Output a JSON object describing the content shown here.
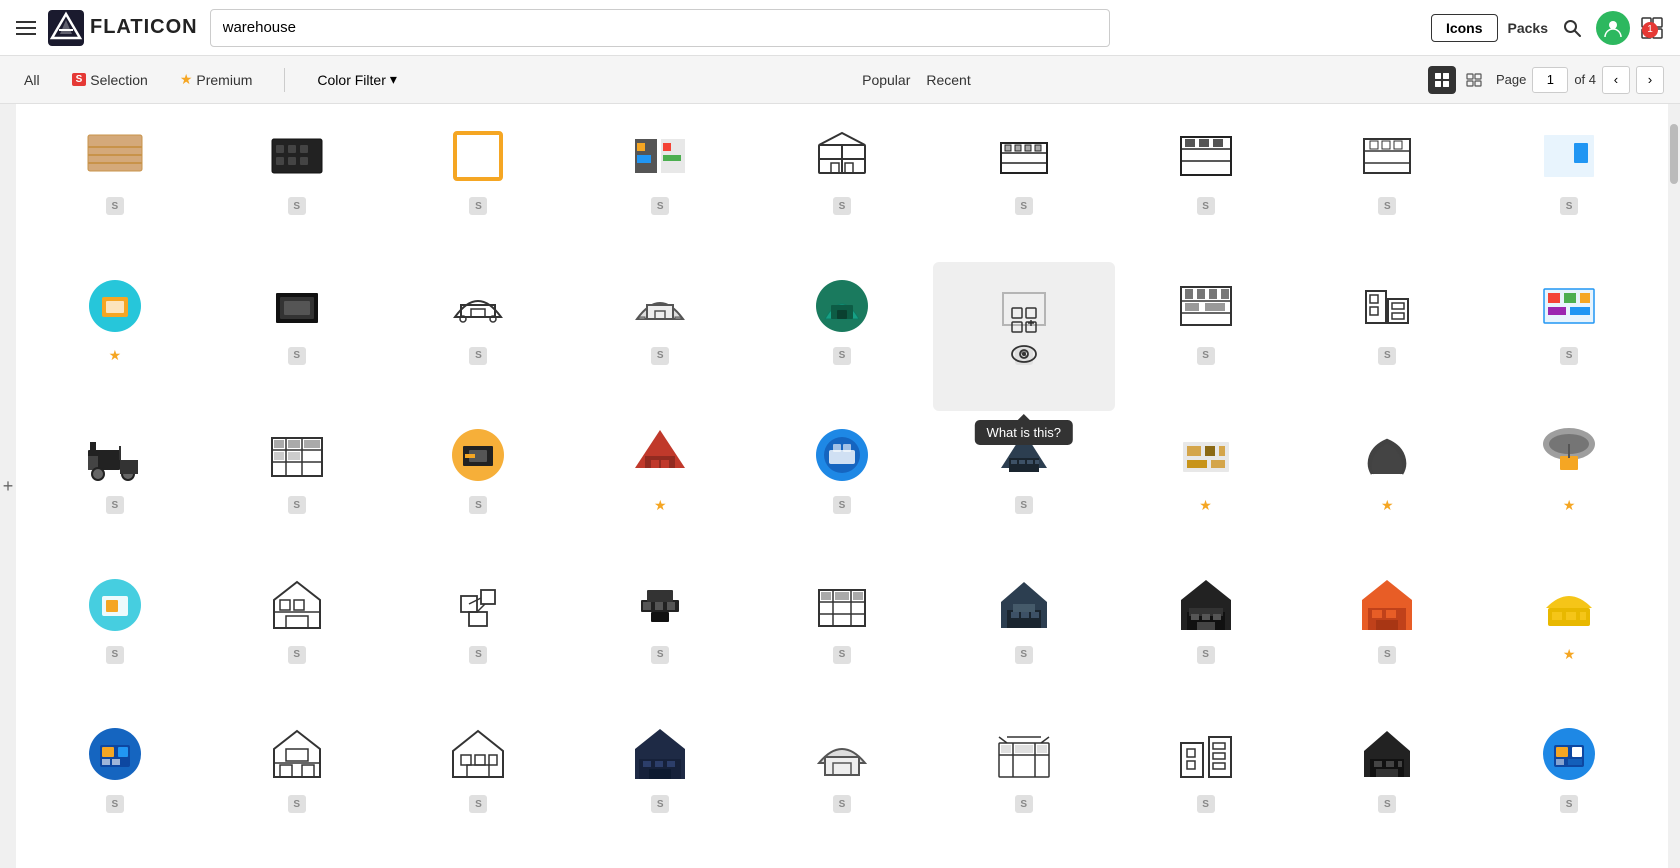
{
  "header": {
    "search_placeholder": "warehouse",
    "search_value": "warehouse",
    "btn_icons": "Icons",
    "btn_packs": "Packs",
    "notification_count": "1",
    "grid_view": "grid-view"
  },
  "subheader": {
    "tab_all": "All",
    "tab_selection": "Selection",
    "tab_premium": "Premium",
    "color_filter": "Color Filter",
    "popular": "Popular",
    "recent": "Recent",
    "page_label": "Page",
    "page_num": "1",
    "page_total": "of 4"
  },
  "tooltip": {
    "text": "What is this?"
  },
  "side_panel": {
    "label": "+"
  },
  "icons": [
    {
      "row": 0,
      "col": 0,
      "type": "s",
      "style": "beige-lines"
    },
    {
      "row": 0,
      "col": 1,
      "type": "s",
      "style": "dark-grid"
    },
    {
      "row": 0,
      "col": 2,
      "type": "s",
      "style": "orange-square"
    },
    {
      "row": 0,
      "col": 3,
      "type": "s",
      "style": "colorful-boxes"
    },
    {
      "row": 0,
      "col": 4,
      "type": "s",
      "style": "outline-building"
    },
    {
      "row": 0,
      "col": 5,
      "type": "s",
      "style": "dark-outline-grid"
    },
    {
      "row": 0,
      "col": 6,
      "type": "s",
      "style": "shelves-dark"
    },
    {
      "row": 0,
      "col": 7,
      "type": "s",
      "style": "shelves-outline"
    },
    {
      "row": 0,
      "col": 8,
      "type": "s",
      "style": "blue-rect"
    },
    {
      "row": 1,
      "col": 0,
      "type": "premium",
      "style": "teal-circle"
    },
    {
      "row": 1,
      "col": 1,
      "type": "s",
      "style": "black-building"
    },
    {
      "row": 1,
      "col": 2,
      "type": "s",
      "style": "arch-outline"
    },
    {
      "row": 1,
      "col": 3,
      "type": "s",
      "style": "arch-outline2"
    },
    {
      "row": 1,
      "col": 4,
      "type": "s",
      "style": "teal-arch"
    },
    {
      "row": 1,
      "col": 5,
      "type": "s",
      "style": "hover-cell",
      "hovered": true
    },
    {
      "row": 1,
      "col": 6,
      "type": "s",
      "style": "shelves-right"
    },
    {
      "row": 1,
      "col": 7,
      "type": "s",
      "style": "boxes-stacked"
    },
    {
      "row": 1,
      "col": 8,
      "type": "s",
      "style": "colored-shelf"
    },
    {
      "row": 2,
      "col": 0,
      "type": "s",
      "style": "forklift"
    },
    {
      "row": 2,
      "col": 1,
      "type": "s",
      "style": "shelves-outline2"
    },
    {
      "row": 2,
      "col": 2,
      "type": "s",
      "style": "building-circle"
    },
    {
      "row": 2,
      "col": 3,
      "type": "premium",
      "style": "red-building"
    },
    {
      "row": 2,
      "col": 4,
      "type": "s",
      "style": "blue-circle-ship"
    },
    {
      "row": 2,
      "col": 5,
      "type": "s",
      "style": "dark-building-grid"
    },
    {
      "row": 2,
      "col": 6,
      "type": "premium",
      "style": "isometric-boxes"
    },
    {
      "row": 2,
      "col": 7,
      "type": "premium",
      "style": "hands-holding"
    },
    {
      "row": 2,
      "col": 8,
      "type": "premium",
      "style": "parachute-box"
    },
    {
      "row": 3,
      "col": 0,
      "type": "s",
      "style": "teal-circle-small"
    },
    {
      "row": 3,
      "col": 1,
      "type": "s",
      "style": "outline-warehouse"
    },
    {
      "row": 3,
      "col": 2,
      "type": "s",
      "style": "boxes-pile"
    },
    {
      "row": 3,
      "col": 3,
      "type": "s",
      "style": "black-boxes-stack"
    },
    {
      "row": 3,
      "col": 4,
      "type": "s",
      "style": "shelves-thin"
    },
    {
      "row": 3,
      "col": 5,
      "type": "s",
      "style": "dark-house-boxes"
    },
    {
      "row": 3,
      "col": 6,
      "type": "s",
      "style": "dark-garage"
    },
    {
      "row": 3,
      "col": 7,
      "type": "s",
      "style": "orange-warehouse"
    },
    {
      "row": 3,
      "col": 8,
      "type": "premium",
      "style": "yellow-dome"
    },
    {
      "row": 4,
      "col": 0,
      "type": "s",
      "style": "blue-circle-building"
    },
    {
      "row": 4,
      "col": 1,
      "type": "s",
      "style": "outline-building2"
    },
    {
      "row": 4,
      "col": 2,
      "type": "s",
      "style": "outline-warehouse2"
    },
    {
      "row": 4,
      "col": 3,
      "type": "s",
      "style": "dark-blue-warehouse"
    },
    {
      "row": 4,
      "col": 4,
      "type": "s",
      "style": "arch-outline3"
    },
    {
      "row": 4,
      "col": 5,
      "type": "s",
      "style": "striped-storefront"
    },
    {
      "row": 4,
      "col": 6,
      "type": "s",
      "style": "city-outline"
    },
    {
      "row": 4,
      "col": 7,
      "type": "s",
      "style": "dark-house2"
    },
    {
      "row": 4,
      "col": 8,
      "type": "s",
      "style": "blue-circle-boxes"
    }
  ]
}
